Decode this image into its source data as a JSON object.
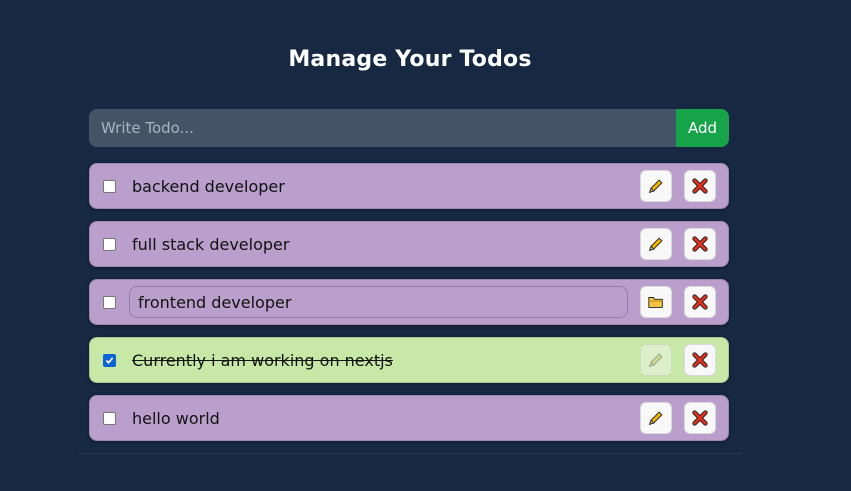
{
  "header": {
    "title": "Manage Your Todos"
  },
  "form": {
    "placeholder": "Write Todo...",
    "add_label": "Add"
  },
  "todos": [
    {
      "text": "backend developer",
      "completed": false,
      "editing": false
    },
    {
      "text": "full stack developer",
      "completed": false,
      "editing": false
    },
    {
      "text": "frontend developer",
      "completed": false,
      "editing": true
    },
    {
      "text": "Currently i am working on nextjs",
      "completed": true,
      "editing": false
    },
    {
      "text": "hello world",
      "completed": false,
      "editing": false
    }
  ],
  "icons": {
    "edit": "pencil-icon",
    "save": "folder-icon",
    "delete": "cross-icon"
  },
  "colors": {
    "background": "#172842",
    "todo_pending": "#ba9fcd",
    "todo_completed": "#c8e8a8",
    "add_button": "#16a34a"
  }
}
